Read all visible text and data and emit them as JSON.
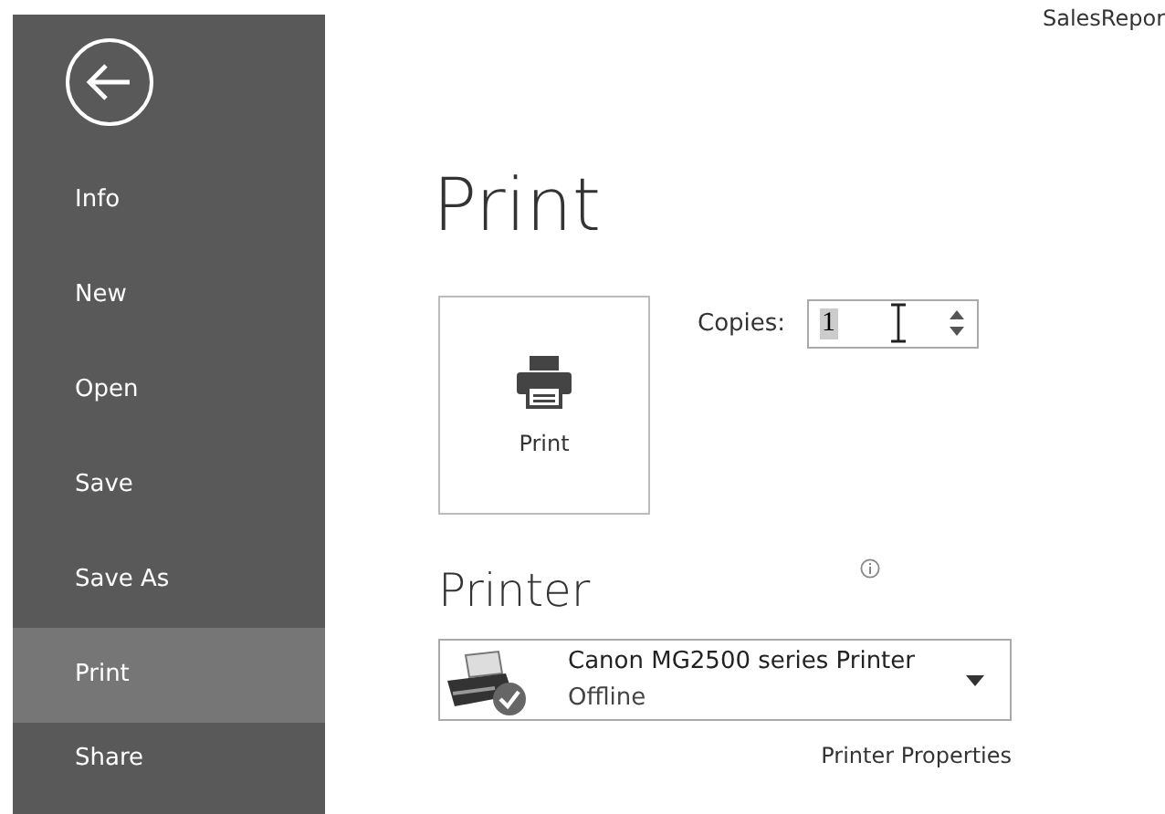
{
  "document_title": "SalesRepor",
  "sidebar": {
    "items": [
      {
        "label": "Info",
        "selected": false
      },
      {
        "label": "New",
        "selected": false
      },
      {
        "label": "Open",
        "selected": false
      },
      {
        "label": "Save",
        "selected": false
      },
      {
        "label": "Save As",
        "selected": false
      },
      {
        "label": "Print",
        "selected": true
      },
      {
        "label": "Share",
        "selected": false
      }
    ]
  },
  "page_title": "Print",
  "print_button": {
    "label": "Print"
  },
  "copies": {
    "label": "Copies:",
    "value": "1"
  },
  "printer": {
    "heading": "Printer",
    "name": "Canon MG2500 series Printer",
    "status": "Offline",
    "properties_link": "Printer Properties"
  }
}
